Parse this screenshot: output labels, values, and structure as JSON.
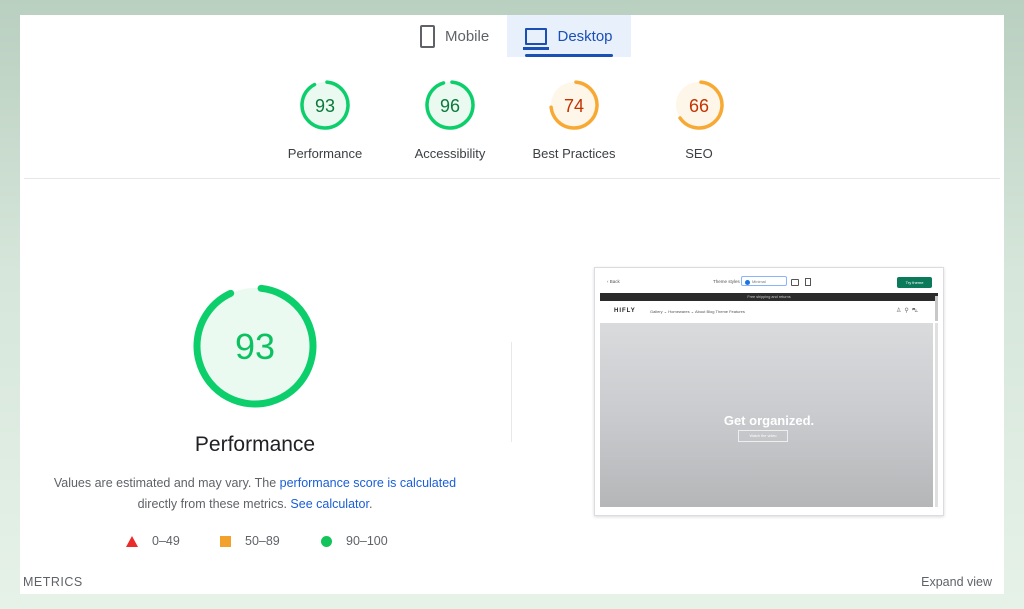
{
  "tabs": [
    {
      "label": "Mobile",
      "icon": "phone-icon",
      "active": false
    },
    {
      "label": "Desktop",
      "icon": "laptop-icon",
      "active": true
    }
  ],
  "scores": [
    {
      "label": "Performance",
      "value": 93,
      "rating": "pass",
      "color": "#0cce6b",
      "text_color": "#0a7a3b",
      "fill": "#eafaf1"
    },
    {
      "label": "Accessibility",
      "value": 96,
      "rating": "pass",
      "color": "#0cce6b",
      "text_color": "#0a7a3b",
      "fill": "#eafaf1"
    },
    {
      "label": "Best Practices",
      "value": 74,
      "rating": "average",
      "color": "#f7a934",
      "text_color": "#c33300",
      "fill": "#fff6ea"
    },
    {
      "label": "SEO",
      "value": 66,
      "rating": "average",
      "color": "#f7a934",
      "text_color": "#c33300",
      "fill": "#fff6ea"
    }
  ],
  "performance": {
    "score": 93,
    "title": "Performance",
    "color": "#0cce6b",
    "text_color": "#0cc15f",
    "desc_prefix": "Values are estimated and may vary. The ",
    "desc_link1": "performance score is calculated",
    "desc_middle": " directly from these metrics. ",
    "desc_link2": "See calculator",
    "desc_suffix": "."
  },
  "legend": [
    {
      "shape": "triangle",
      "range": "0–49",
      "color": "#eb2a2a"
    },
    {
      "shape": "square",
      "range": "50–89",
      "color": "#f2a12c"
    },
    {
      "shape": "circle",
      "range": "90–100",
      "color": "#12c45a"
    }
  ],
  "screenshot": {
    "back": "Back",
    "theme_label": "Theme styles",
    "theme_select": "Minimal",
    "try_button": "Try theme",
    "announcement": "Free shipping and returns",
    "logo": "HIFLY",
    "nav": "Gallery ⌄   Homewares ⌄   About   Blog   Theme Features",
    "hero_title": "Get organized.",
    "hero_button": "Watch the video"
  },
  "footer": {
    "metrics_label": "METRICS",
    "expand_label": "Expand view"
  }
}
